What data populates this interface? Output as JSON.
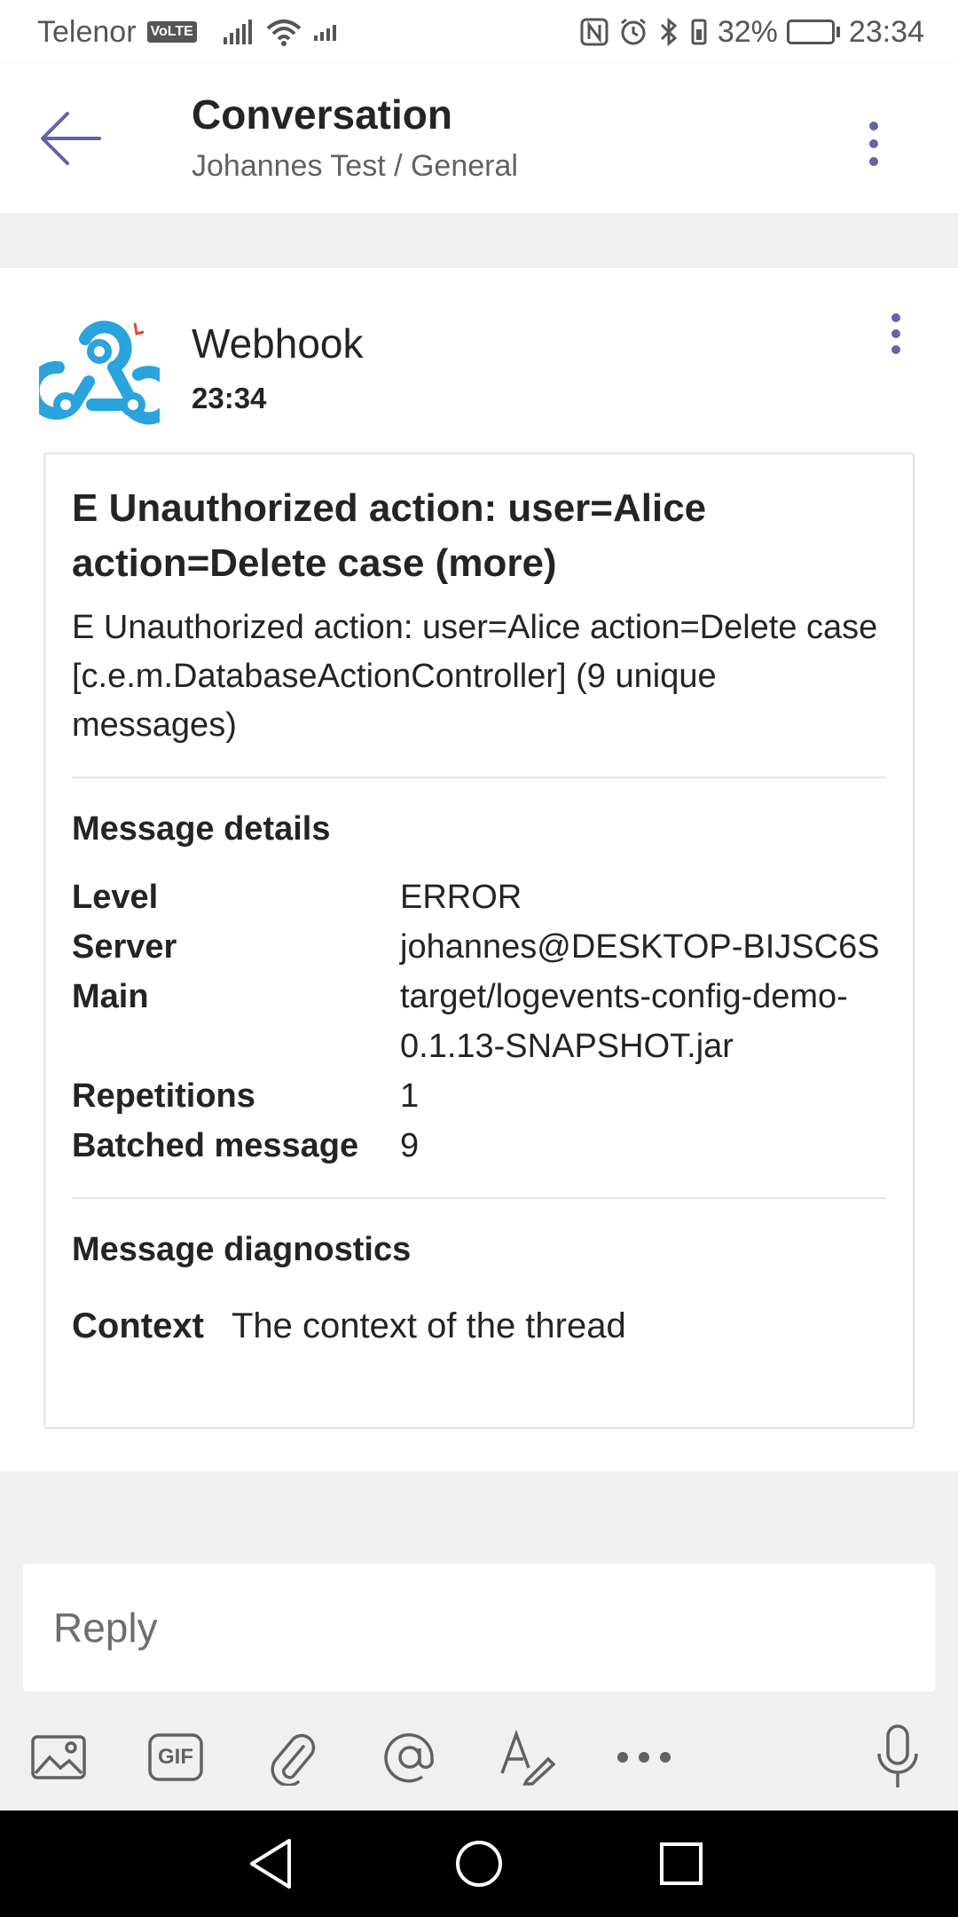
{
  "status_bar": {
    "carrier": "Telenor",
    "volte": "VoLTE",
    "battery_percent": "32%",
    "time": "23:34",
    "battery_level": 0.32
  },
  "header": {
    "title": "Conversation",
    "subtitle": "Johannes Test / General"
  },
  "message": {
    "sender": "Webhook",
    "time": "23:34",
    "card": {
      "title": "E Unauthorized action: user=Alice action=Delete case (more)",
      "text": "E Unauthorized action: user=Alice action=Delete case [c.e.m.DatabaseActionController] (9 unique messages)",
      "details_title": "Message details",
      "facts": [
        {
          "key": "Level",
          "value": "ERROR"
        },
        {
          "key": "Server",
          "value": "johannes@DESKTOP­-BIJSC6S"
        },
        {
          "key": "Main",
          "value": "target/logevents-config-demo-0.1.13-SNAPSHOT.jar"
        },
        {
          "key": "Repetitions",
          "value": "1"
        },
        {
          "key": "Batched message",
          "value": "9"
        }
      ],
      "diagnostics_title": "Message diagnostics",
      "context_key": "Context",
      "context_value": "The context of the thread"
    }
  },
  "reply": {
    "placeholder": "Reply"
  },
  "toolbar": {
    "gif_label": "GIF"
  },
  "colors": {
    "accent": "#6264a7",
    "webhook_blue": "#2ba3dc"
  }
}
